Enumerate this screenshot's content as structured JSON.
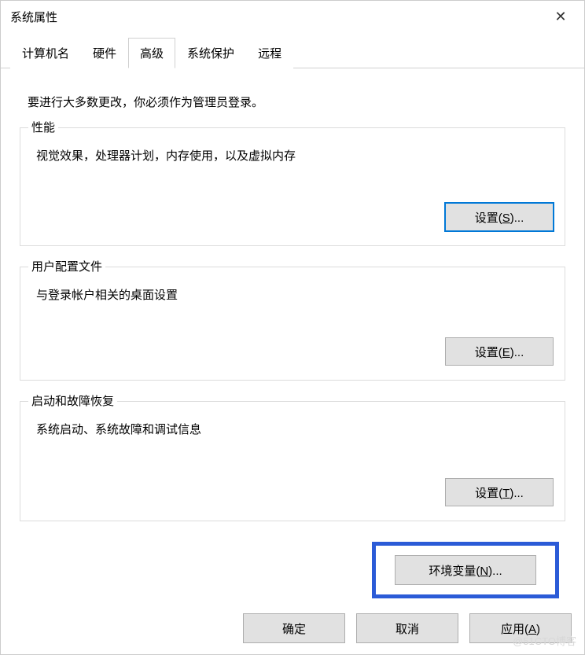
{
  "window": {
    "title": "系统属性"
  },
  "tabs": {
    "computer_name": "计算机名",
    "hardware": "硬件",
    "advanced": "高级",
    "system_protection": "系统保护",
    "remote": "远程"
  },
  "advanced_tab": {
    "instruction": "要进行大多数更改，你必须作为管理员登录。",
    "performance": {
      "title": "性能",
      "desc": "视觉效果，处理器计划，内存使用，以及虚拟内存",
      "button": "设置(S)...",
      "button_underline": "S"
    },
    "user_profiles": {
      "title": "用户配置文件",
      "desc": "与登录帐户相关的桌面设置",
      "button": "设置(E)...",
      "button_underline": "E"
    },
    "startup_recovery": {
      "title": "启动和故障恢复",
      "desc": "系统启动、系统故障和调试信息",
      "button": "设置(T)...",
      "button_underline": "T"
    },
    "env_vars": {
      "button": "环境变量(N)...",
      "button_underline": "N"
    }
  },
  "dialog_buttons": {
    "ok": "确定",
    "cancel": "取消",
    "apply": "应用(A)",
    "apply_underline": "A"
  },
  "watermark": "@51CTO博客"
}
